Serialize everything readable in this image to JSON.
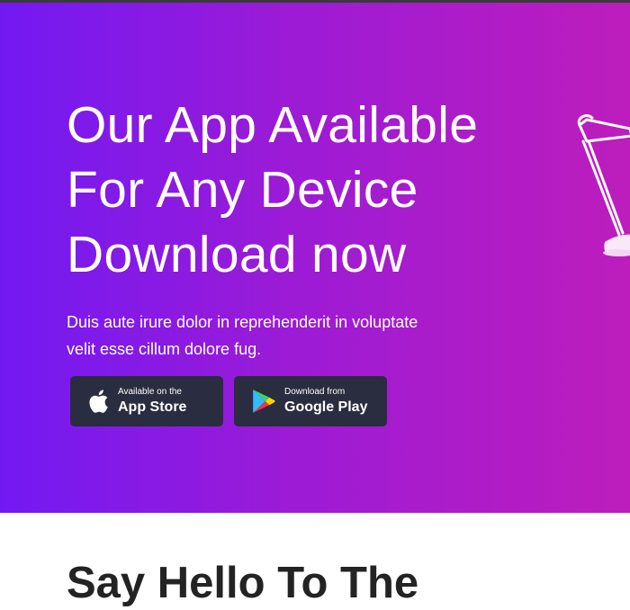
{
  "hero": {
    "title_lines": [
      "Our App Available",
      "For Any Device",
      "Download now"
    ],
    "description": "Duis aute irure dolor in reprehenderit in voluptate velit esse cillum dolore fug.",
    "buttons": {
      "app_store": {
        "small": "Available on the",
        "big": "App Store",
        "icon": "apple-icon"
      },
      "google_play": {
        "small": "Download from",
        "big": "Google Play",
        "icon": "google-play-icon"
      }
    },
    "colors": {
      "gradient_start": "#7219f3",
      "gradient_end": "#bd1dbc",
      "button_bg": "#2a2c3f"
    },
    "decoration": "desk-lamp-illustration"
  },
  "next_section": {
    "heading": "Say Hello To The"
  }
}
